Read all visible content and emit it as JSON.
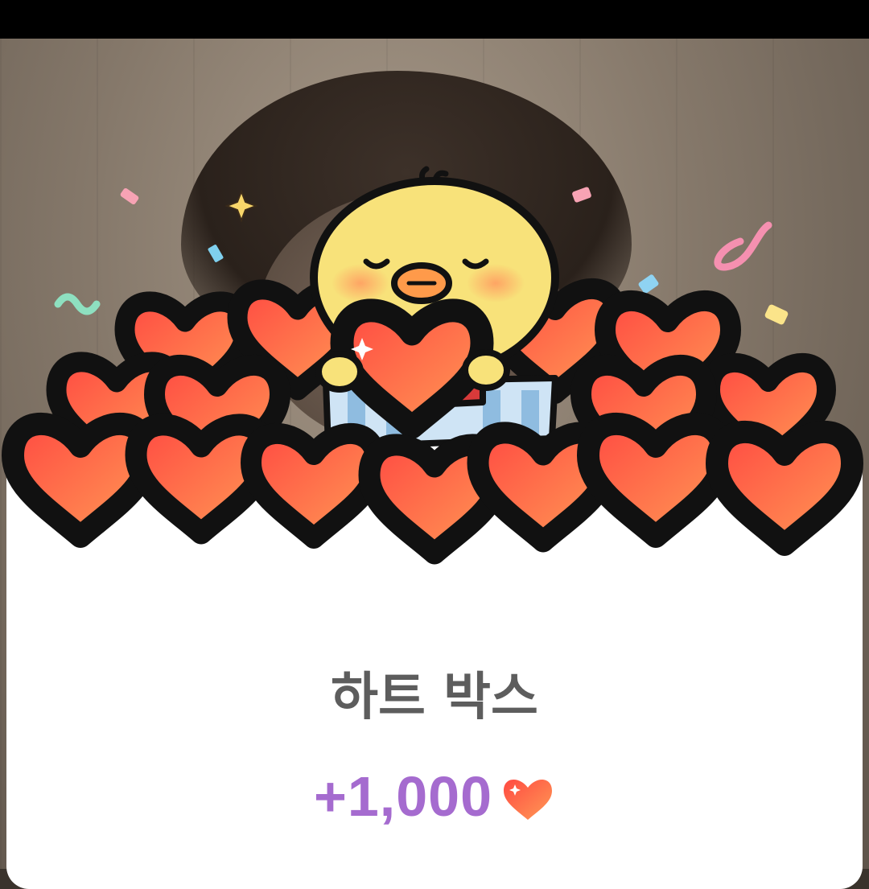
{
  "reward": {
    "title": "하트 박스",
    "amount": "+1,000",
    "currency_icon": "heart-icon"
  },
  "illustration": {
    "name": "heart-box-reward",
    "character": "yellow-chick",
    "object": "heart-box"
  },
  "colors": {
    "title": "#5d5d5d",
    "amount": "#a56bcf",
    "heart_light": "#ff9a55",
    "heart_dark": "#ff4a42",
    "card": "#ffffff"
  }
}
